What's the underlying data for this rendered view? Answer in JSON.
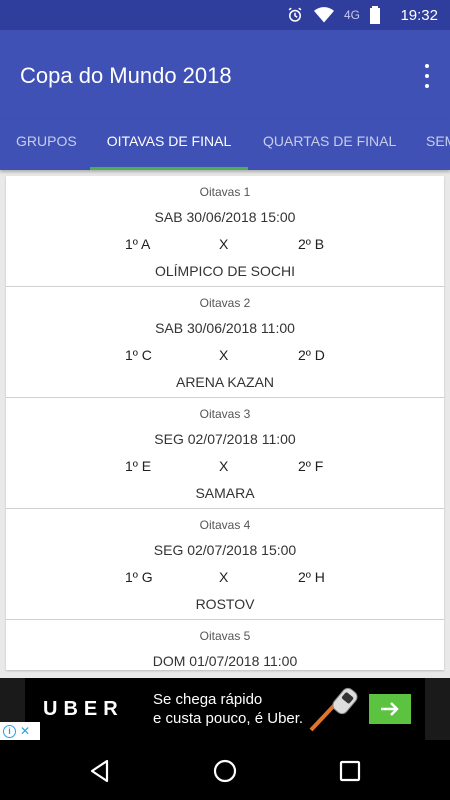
{
  "status_bar": {
    "network": "4G",
    "time": "19:32"
  },
  "app_bar": {
    "title": "Copa do Mundo 2018",
    "menu_icon": "more-vert-icon"
  },
  "tabs": [
    {
      "label": "GRUPOS",
      "active": false
    },
    {
      "label": "OITAVAS DE FINAL",
      "active": true
    },
    {
      "label": "QUARTAS DE FINAL",
      "active": false
    },
    {
      "label": "SEMI",
      "active": false
    }
  ],
  "matches": [
    {
      "round": "Oitavas 1",
      "datetime": "SAB 30/06/2018 15:00",
      "team1": "1º A",
      "vs": "X",
      "team2": "2º B",
      "stadium": "OLÍMPICO DE SOCHI"
    },
    {
      "round": "Oitavas 2",
      "datetime": "SAB 30/06/2018 11:00",
      "team1": "1º C",
      "vs": "X",
      "team2": "2º D",
      "stadium": "ARENA KAZAN"
    },
    {
      "round": "Oitavas 3",
      "datetime": "SEG 02/07/2018 11:00",
      "team1": "1º E",
      "vs": "X",
      "team2": "2º F",
      "stadium": "SAMARA"
    },
    {
      "round": "Oitavas 4",
      "datetime": "SEG 02/07/2018 15:00",
      "team1": "1º G",
      "vs": "X",
      "team2": "2º H",
      "stadium": "ROSTOV"
    },
    {
      "round": "Oitavas 5",
      "datetime": "DOM 01/07/2018 11:00",
      "team1": "",
      "vs": "",
      "team2": "",
      "stadium": ""
    }
  ],
  "ad": {
    "brand": "UBER",
    "slogan_line1": "Se chega rápido",
    "slogan_line2": "e custa pouco, é Uber."
  },
  "colors": {
    "status_bar": "#2f3d9c",
    "app_bar": "#3f51b5",
    "tab_indicator": "#4caf50",
    "ad_button": "#5cc341"
  }
}
